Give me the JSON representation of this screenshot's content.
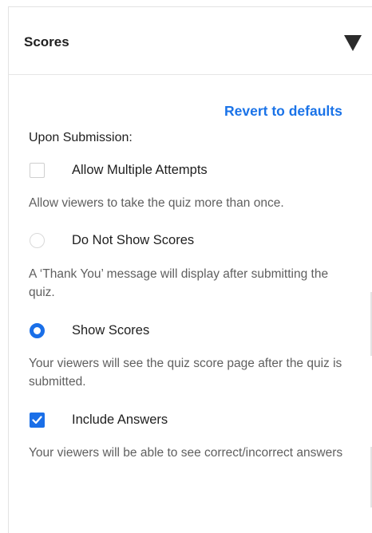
{
  "header": {
    "title": "Scores",
    "toggle_icon": "caret-down-icon"
  },
  "revert_label": "Revert to defaults",
  "section_label": "Upon Submission:",
  "options": [
    {
      "label": "Allow Multiple Attempts",
      "type": "checkbox",
      "checked": false,
      "description": "Allow viewers to take the quiz more than once."
    },
    {
      "label": "Do Not Show Scores",
      "type": "radio",
      "checked": false,
      "description": "A ‘Thank You’ message will display after submitting the quiz."
    },
    {
      "label": "Show Scores",
      "type": "radio",
      "checked": true,
      "description": "Your viewers will see the quiz score page after the quiz is submitted."
    },
    {
      "label": "Include Answers",
      "type": "checkbox",
      "checked": true,
      "description": "Your viewers will be able to see correct/incorrect answers"
    }
  ],
  "colors": {
    "accent": "#1a6fe8",
    "link": "#1a73e8",
    "text": "#1f1f1f",
    "muted": "#5f5f5f"
  }
}
